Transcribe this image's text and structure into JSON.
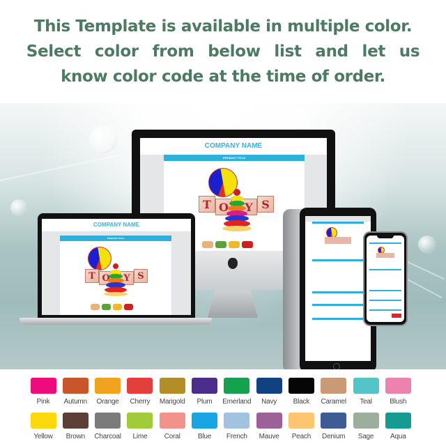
{
  "headline": {
    "line1": "This Template is available in multiple color.",
    "line2": "Select color from below list and let us",
    "line3": "know color code at the time of order.",
    "color": "#4d7a63"
  },
  "mockup": {
    "company_name": "COMPANY NAME",
    "product_title": "PRODUCT TITLE",
    "toy_letters": [
      "T",
      "O",
      "Y",
      "S"
    ],
    "accent_color": "#31afdb",
    "devices": [
      "desktop-monitor",
      "laptop",
      "tablet",
      "smartphone"
    ],
    "monitor_logo": "apple-icon"
  },
  "swatches": {
    "row1": [
      {
        "name": "Pink",
        "color": "#ec0c7d"
      },
      {
        "name": "Autumn",
        "color": "#c9562a"
      },
      {
        "name": "Orange",
        "color": "#f1a21e"
      },
      {
        "name": "Cherry",
        "color": "#e33f3c"
      },
      {
        "name": "Marigold",
        "color": "#b38e28"
      },
      {
        "name": "Plum",
        "color": "#4b2d8c"
      },
      {
        "name": "Emerland",
        "color": "#15a24f"
      },
      {
        "name": "Navy",
        "color": "#11427f"
      },
      {
        "name": "Black",
        "color": "#060606"
      },
      {
        "name": "Caramel",
        "color": "#c99a76"
      },
      {
        "name": "Teal",
        "color": "#55c4c8"
      },
      {
        "name": "Blush",
        "color": "#ec82ae"
      }
    ],
    "row2": [
      {
        "name": "Yellow",
        "color": "#fcd90c"
      },
      {
        "name": "Brown",
        "color": "#5c4038"
      },
      {
        "name": "Charcoal",
        "color": "#7b7b7b"
      },
      {
        "name": "Lime",
        "color": "#a2cb3a"
      },
      {
        "name": "Coral",
        "color": "#f2928a"
      },
      {
        "name": "Blue",
        "color": "#18a5e5"
      },
      {
        "name": "French",
        "color": "#a1c3e0"
      },
      {
        "name": "Mauve",
        "color": "#9e6197"
      },
      {
        "name": "Peach",
        "color": "#fdc56f"
      },
      {
        "name": "Denium",
        "color": "#3d5b95"
      },
      {
        "name": "Sage",
        "color": "#9caf9c"
      },
      {
        "name": "Aqua",
        "color": "#159b8f"
      }
    ]
  }
}
